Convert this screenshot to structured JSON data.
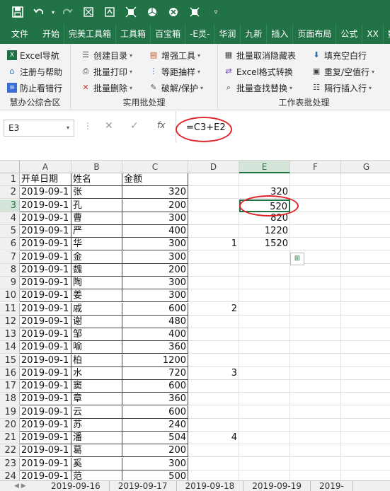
{
  "qat": {
    "save_icon": "save-icon",
    "undo_icon": "undo-icon",
    "redo_icon": "redo-icon"
  },
  "tabs": [
    "文件",
    "开始",
    "完美工具箱",
    "工具箱",
    "百宝箱",
    "-E灵-",
    "华润",
    "九新",
    "插入",
    "页面布局",
    "公式",
    "XX",
    "数据"
  ],
  "ribbon": {
    "group1": {
      "items": [
        "Excel导航",
        "注册与帮助",
        "防止看错行"
      ],
      "label": "慧办公综合区"
    },
    "group2": {
      "items": [
        "创建目录",
        "增强工具",
        "批量打印",
        "等距抽样",
        "批量删除",
        "破解/保护"
      ],
      "label": "实用批处理"
    },
    "group3": {
      "items": [
        "批量取消隐藏表",
        "填充空白行",
        "Excel格式转换",
        "重复/空值行",
        "批量查找替换",
        "隔行插入行"
      ],
      "label": "工作表批处理"
    }
  },
  "formula_bar": {
    "name_box": "E3",
    "formula": "=C3+E2",
    "fx": "fx",
    "cancel": "✕",
    "enter": "✓"
  },
  "columns": [
    "A",
    "B",
    "C",
    "D",
    "E",
    "F",
    "G"
  ],
  "rows": [
    {
      "n": "1",
      "a": "开单日期",
      "b": "姓名",
      "c": "金额",
      "d": "",
      "e": ""
    },
    {
      "n": "2",
      "a": "2019-09-1",
      "b": "张",
      "c": "320",
      "d": "",
      "e": "320"
    },
    {
      "n": "3",
      "a": "2019-09-1",
      "b": "孔",
      "c": "200",
      "d": "",
      "e": "520"
    },
    {
      "n": "4",
      "a": "2019-09-1",
      "b": "曹",
      "c": "300",
      "d": "",
      "e": "820"
    },
    {
      "n": "5",
      "a": "2019-09-1",
      "b": "严",
      "c": "400",
      "d": "",
      "e": "1220"
    },
    {
      "n": "6",
      "a": "2019-09-1",
      "b": "华",
      "c": "300",
      "d": "1",
      "e": "1520"
    },
    {
      "n": "7",
      "a": "2019-09-1",
      "b": "金",
      "c": "300",
      "d": "",
      "e": ""
    },
    {
      "n": "8",
      "a": "2019-09-1",
      "b": "魏",
      "c": "200",
      "d": "",
      "e": ""
    },
    {
      "n": "9",
      "a": "2019-09-1",
      "b": "陶",
      "c": "300",
      "d": "",
      "e": ""
    },
    {
      "n": "10",
      "a": "2019-09-1",
      "b": "姜",
      "c": "300",
      "d": "",
      "e": ""
    },
    {
      "n": "11",
      "a": "2019-09-1",
      "b": "戚",
      "c": "600",
      "d": "2",
      "e": ""
    },
    {
      "n": "12",
      "a": "2019-09-1",
      "b": "谢",
      "c": "480",
      "d": "",
      "e": ""
    },
    {
      "n": "13",
      "a": "2019-09-1",
      "b": "邹",
      "c": "400",
      "d": "",
      "e": ""
    },
    {
      "n": "14",
      "a": "2019-09-1",
      "b": "喻",
      "c": "360",
      "d": "",
      "e": ""
    },
    {
      "n": "15",
      "a": "2019-09-1",
      "b": "柏",
      "c": "1200",
      "d": "",
      "e": ""
    },
    {
      "n": "16",
      "a": "2019-09-1",
      "b": "水",
      "c": "720",
      "d": "3",
      "e": ""
    },
    {
      "n": "17",
      "a": "2019-09-1",
      "b": "窦",
      "c": "600",
      "d": "",
      "e": ""
    },
    {
      "n": "18",
      "a": "2019-09-1",
      "b": "章",
      "c": "360",
      "d": "",
      "e": ""
    },
    {
      "n": "19",
      "a": "2019-09-1",
      "b": "云",
      "c": "600",
      "d": "",
      "e": ""
    },
    {
      "n": "20",
      "a": "2019-09-1",
      "b": "苏",
      "c": "240",
      "d": "",
      "e": ""
    },
    {
      "n": "21",
      "a": "2019-09-1",
      "b": "潘",
      "c": "504",
      "d": "4",
      "e": ""
    },
    {
      "n": "22",
      "a": "2019-09-1",
      "b": "葛",
      "c": "200",
      "d": "",
      "e": ""
    },
    {
      "n": "23",
      "a": "2019-09-1",
      "b": "奚",
      "c": "300",
      "d": "",
      "e": ""
    },
    {
      "n": "24",
      "a": "2019-09-1",
      "b": "范",
      "c": "500",
      "d": "",
      "e": ""
    }
  ],
  "sheet_tabs": [
    "2019-09-16",
    "2019-09-17",
    "2019-09-18",
    "2019-09-19",
    "2019-"
  ],
  "colors": {
    "accent": "#217346",
    "annotation": "#e0222a"
  }
}
